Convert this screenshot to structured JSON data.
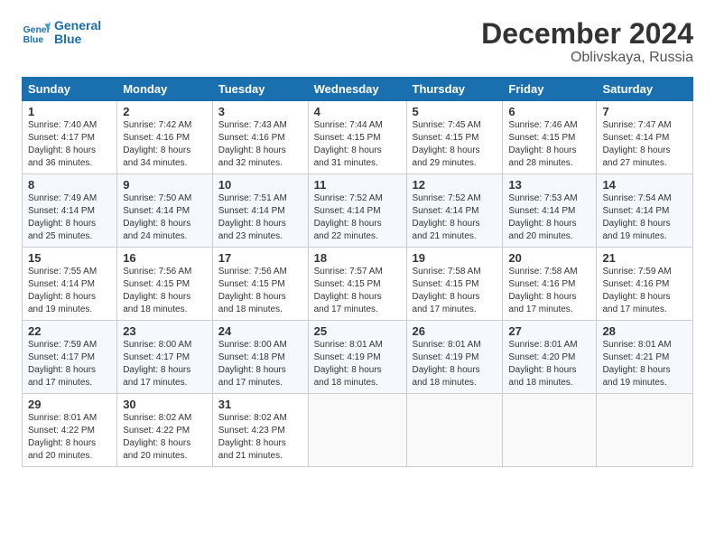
{
  "header": {
    "logo_line1": "General",
    "logo_line2": "Blue",
    "month": "December 2024",
    "location": "Oblivskaya, Russia"
  },
  "weekdays": [
    "Sunday",
    "Monday",
    "Tuesday",
    "Wednesday",
    "Thursday",
    "Friday",
    "Saturday"
  ],
  "weeks": [
    [
      {
        "day": "1",
        "sunrise": "7:40 AM",
        "sunset": "4:17 PM",
        "daylight": "8 hours and 36 minutes."
      },
      {
        "day": "2",
        "sunrise": "7:42 AM",
        "sunset": "4:16 PM",
        "daylight": "8 hours and 34 minutes."
      },
      {
        "day": "3",
        "sunrise": "7:43 AM",
        "sunset": "4:16 PM",
        "daylight": "8 hours and 32 minutes."
      },
      {
        "day": "4",
        "sunrise": "7:44 AM",
        "sunset": "4:15 PM",
        "daylight": "8 hours and 31 minutes."
      },
      {
        "day": "5",
        "sunrise": "7:45 AM",
        "sunset": "4:15 PM",
        "daylight": "8 hours and 29 minutes."
      },
      {
        "day": "6",
        "sunrise": "7:46 AM",
        "sunset": "4:15 PM",
        "daylight": "8 hours and 28 minutes."
      },
      {
        "day": "7",
        "sunrise": "7:47 AM",
        "sunset": "4:14 PM",
        "daylight": "8 hours and 27 minutes."
      }
    ],
    [
      {
        "day": "8",
        "sunrise": "7:49 AM",
        "sunset": "4:14 PM",
        "daylight": "8 hours and 25 minutes."
      },
      {
        "day": "9",
        "sunrise": "7:50 AM",
        "sunset": "4:14 PM",
        "daylight": "8 hours and 24 minutes."
      },
      {
        "day": "10",
        "sunrise": "7:51 AM",
        "sunset": "4:14 PM",
        "daylight": "8 hours and 23 minutes."
      },
      {
        "day": "11",
        "sunrise": "7:52 AM",
        "sunset": "4:14 PM",
        "daylight": "8 hours and 22 minutes."
      },
      {
        "day": "12",
        "sunrise": "7:52 AM",
        "sunset": "4:14 PM",
        "daylight": "8 hours and 21 minutes."
      },
      {
        "day": "13",
        "sunrise": "7:53 AM",
        "sunset": "4:14 PM",
        "daylight": "8 hours and 20 minutes."
      },
      {
        "day": "14",
        "sunrise": "7:54 AM",
        "sunset": "4:14 PM",
        "daylight": "8 hours and 19 minutes."
      }
    ],
    [
      {
        "day": "15",
        "sunrise": "7:55 AM",
        "sunset": "4:14 PM",
        "daylight": "8 hours and 19 minutes."
      },
      {
        "day": "16",
        "sunrise": "7:56 AM",
        "sunset": "4:15 PM",
        "daylight": "8 hours and 18 minutes."
      },
      {
        "day": "17",
        "sunrise": "7:56 AM",
        "sunset": "4:15 PM",
        "daylight": "8 hours and 18 minutes."
      },
      {
        "day": "18",
        "sunrise": "7:57 AM",
        "sunset": "4:15 PM",
        "daylight": "8 hours and 17 minutes."
      },
      {
        "day": "19",
        "sunrise": "7:58 AM",
        "sunset": "4:15 PM",
        "daylight": "8 hours and 17 minutes."
      },
      {
        "day": "20",
        "sunrise": "7:58 AM",
        "sunset": "4:16 PM",
        "daylight": "8 hours and 17 minutes."
      },
      {
        "day": "21",
        "sunrise": "7:59 AM",
        "sunset": "4:16 PM",
        "daylight": "8 hours and 17 minutes."
      }
    ],
    [
      {
        "day": "22",
        "sunrise": "7:59 AM",
        "sunset": "4:17 PM",
        "daylight": "8 hours and 17 minutes."
      },
      {
        "day": "23",
        "sunrise": "8:00 AM",
        "sunset": "4:17 PM",
        "daylight": "8 hours and 17 minutes."
      },
      {
        "day": "24",
        "sunrise": "8:00 AM",
        "sunset": "4:18 PM",
        "daylight": "8 hours and 17 minutes."
      },
      {
        "day": "25",
        "sunrise": "8:01 AM",
        "sunset": "4:19 PM",
        "daylight": "8 hours and 18 minutes."
      },
      {
        "day": "26",
        "sunrise": "8:01 AM",
        "sunset": "4:19 PM",
        "daylight": "8 hours and 18 minutes."
      },
      {
        "day": "27",
        "sunrise": "8:01 AM",
        "sunset": "4:20 PM",
        "daylight": "8 hours and 18 minutes."
      },
      {
        "day": "28",
        "sunrise": "8:01 AM",
        "sunset": "4:21 PM",
        "daylight": "8 hours and 19 minutes."
      }
    ],
    [
      {
        "day": "29",
        "sunrise": "8:01 AM",
        "sunset": "4:22 PM",
        "daylight": "8 hours and 20 minutes."
      },
      {
        "day": "30",
        "sunrise": "8:02 AM",
        "sunset": "4:22 PM",
        "daylight": "8 hours and 20 minutes."
      },
      {
        "day": "31",
        "sunrise": "8:02 AM",
        "sunset": "4:23 PM",
        "daylight": "8 hours and 21 minutes."
      },
      null,
      null,
      null,
      null
    ]
  ]
}
